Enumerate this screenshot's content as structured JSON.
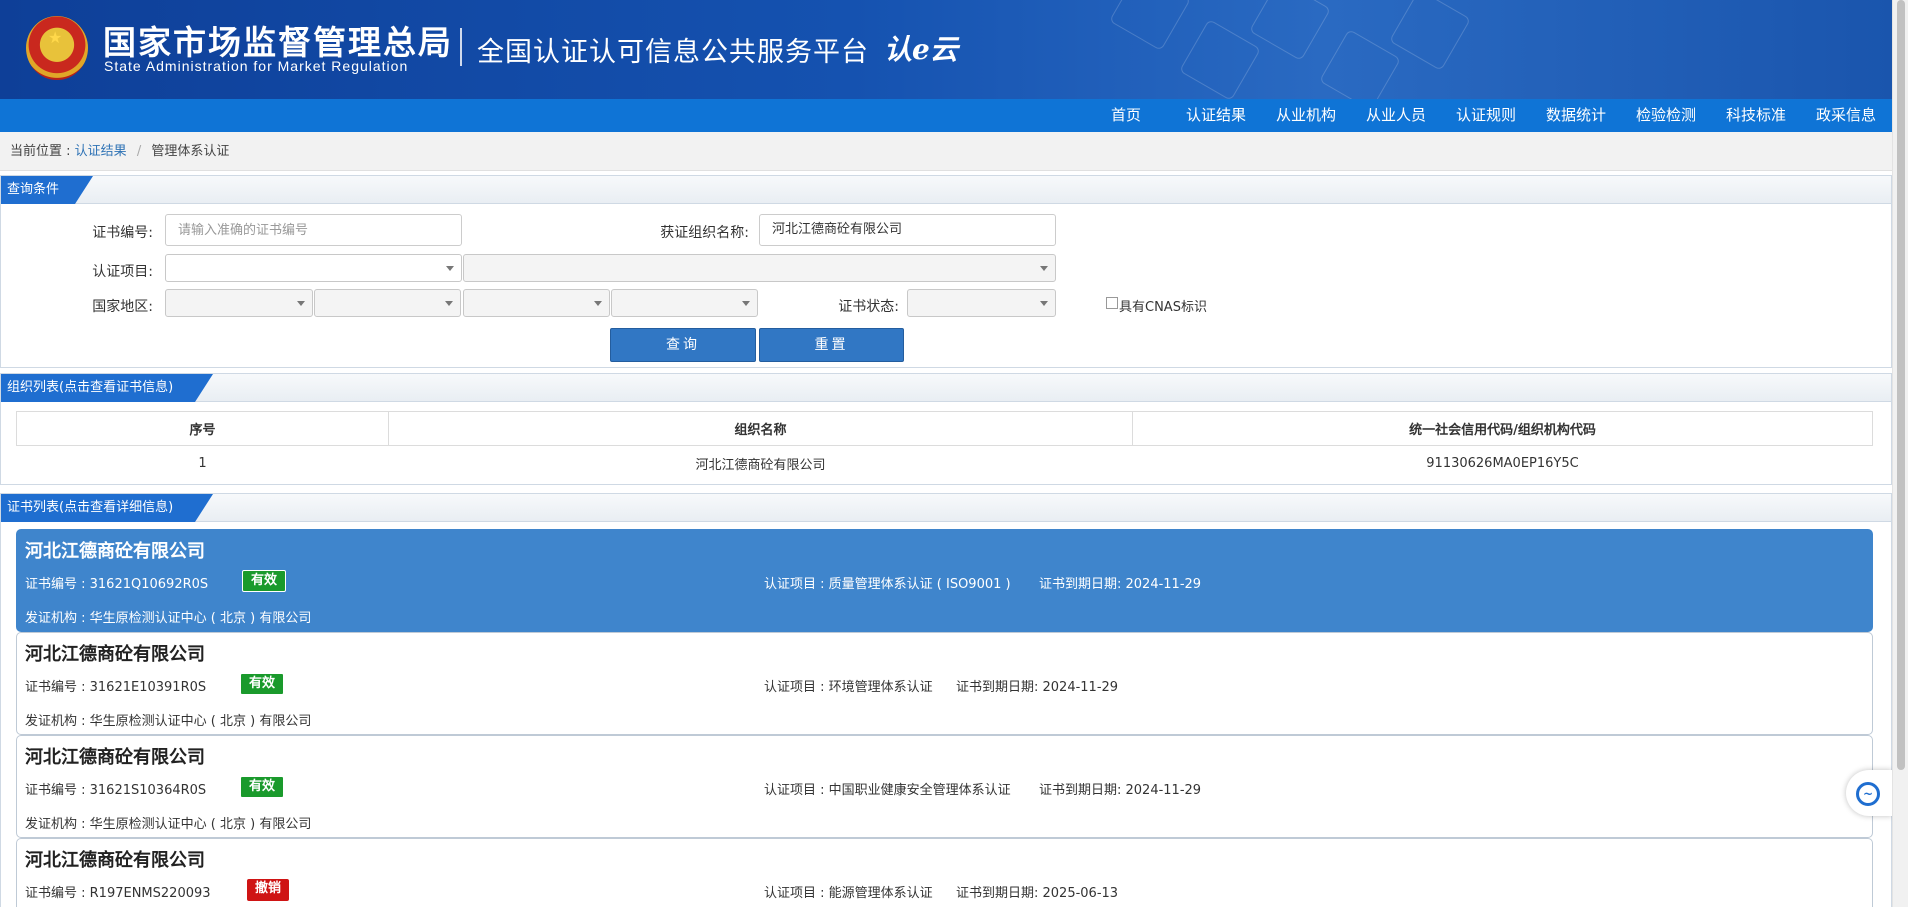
{
  "header": {
    "brand_cn": "国家市场监督管理总局",
    "brand_en": "State Administration  for  Market Regulation",
    "platform": "全国认证认可信息公共服务平台",
    "logo_text": "认e云"
  },
  "nav": [
    "首页",
    "认证结果",
    "从业机构",
    "从业人员",
    "认证规则",
    "数据统计",
    "检验检测",
    "科技标准",
    "政采信息"
  ],
  "breadcrumb": {
    "prefix": "当前位置 :",
    "link": "认证结果",
    "sep": "/",
    "current": "管理体系认证"
  },
  "query": {
    "title": "查询条件",
    "cert_no_label": "证书编号:",
    "cert_no_placeholder": "请输入准确的证书编号",
    "org_label": "获证组织名称:",
    "org_value": "河北江德商砼有限公司",
    "project_label": "认证项目:",
    "region_label": "国家地区:",
    "status_label": "证书状态:",
    "cnas_label": "具有CNAS标识",
    "search_btn": "查询",
    "reset_btn": "重置"
  },
  "org_list": {
    "title": "组织列表(点击查看证书信息)",
    "headers": [
      "序号",
      "组织名称",
      "统一社会信用代码/组织机构代码"
    ],
    "rows": [
      [
        "1",
        "河北江德商砼有限公司",
        "91130626MA0EP16Y5C"
      ]
    ]
  },
  "cert_list": {
    "title": "证书列表(点击查看详细信息)",
    "items": [
      {
        "name": "河北江德商砼有限公司",
        "cert_no": "证书编号 : 31621Q10692R0S",
        "status": "有效",
        "status_type": "ok",
        "project": "认证项目 : 质量管理体系认证 ( ISO9001 )",
        "expiry": "证书到期日期: 2024-11-29",
        "issuer": "发证机构 : 华生原检测认证中心 ( 北京 ) 有限公司"
      },
      {
        "name": "河北江德商砼有限公司",
        "cert_no": "证书编号 : 31621E10391R0S",
        "status": "有效",
        "status_type": "ok",
        "project": "认证项目 : 环境管理体系认证",
        "expiry": "证书到期日期: 2024-11-29",
        "issuer": "发证机构 : 华生原检测认证中心 ( 北京 ) 有限公司"
      },
      {
        "name": "河北江德商砼有限公司",
        "cert_no": "证书编号 : 31621S10364R0S",
        "status": "有效",
        "status_type": "ok",
        "project": "认证项目 : 中国职业健康安全管理体系认证",
        "expiry": "证书到期日期: 2024-11-29",
        "issuer": "发证机构 : 华生原检测认证中心 ( 北京 ) 有限公司"
      },
      {
        "name": "河北江德商砼有限公司",
        "cert_no": "证书编号 : R197ENMS220093",
        "status": "撤销",
        "status_type": "bad",
        "project": "认证项目 : 能源管理体系认证",
        "expiry": "证书到期日期: 2025-06-13",
        "issuer": ""
      }
    ]
  },
  "colors": {
    "nav_bg": "#0f74d6",
    "active_card": "#3f85cc",
    "valid": "#1a9a2c",
    "revoked": "#cf1414"
  }
}
